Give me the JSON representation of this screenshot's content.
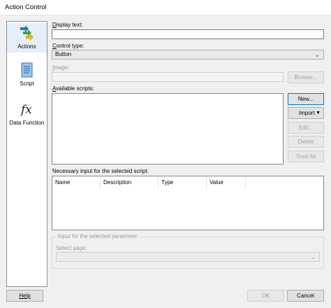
{
  "window": {
    "title": "Action Control"
  },
  "sidebar": {
    "items": [
      {
        "label": "Actions",
        "icon": "arrows-icon"
      },
      {
        "label": "Script",
        "icon": "script-icon"
      },
      {
        "label": "Data Function",
        "icon": "function-icon"
      }
    ]
  },
  "form": {
    "display_text": {
      "label_first": "D",
      "label_rest": "isplay text:",
      "value": ""
    },
    "control_type": {
      "label_first": "C",
      "label_rest": "ontrol type:",
      "value": "Button"
    },
    "image": {
      "label_first": "I",
      "label_rest": "mage:",
      "value": "",
      "browse_label": "Browse..."
    },
    "available_scripts": {
      "label_first": "A",
      "label_rest": "vailable scripts:",
      "items": []
    },
    "script_buttons": {
      "new_label": "New...",
      "import_label": "Import",
      "edit_label": "Edit...",
      "delete_label": "Delete",
      "trust_label": "Trust All"
    },
    "necessary_input": {
      "label": "Necessary input for the selected script:",
      "columns": [
        "Name",
        "Description",
        "Type",
        "Value"
      ],
      "rows": []
    },
    "parameter_group": {
      "label": "Input for the selected parameter",
      "select_page_label": "Select page:",
      "select_page_value": ""
    }
  },
  "footer": {
    "help_label": "Help",
    "ok_label": "OK",
    "cancel_label": "Cancel"
  },
  "colors": {
    "accent": "#0078d7",
    "active_sidebar": "#e5eef9",
    "arrow_blue": "#2f6fc6",
    "arrow_green": "#3aa35a",
    "arrow_yellow": "#e6b400"
  }
}
